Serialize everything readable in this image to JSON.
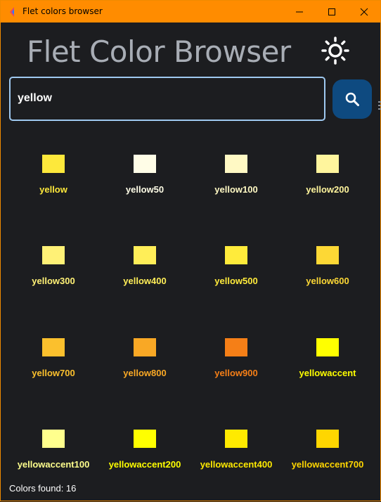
{
  "window": {
    "title": "Flet colors browser",
    "controls": [
      "minimize-icon",
      "maximize-icon",
      "close-icon"
    ]
  },
  "header": {
    "title": "Flet Color Browser",
    "theme_icon": "sun-icon"
  },
  "search": {
    "value": "yellow",
    "button_icon": "search-icon"
  },
  "colors": [
    {
      "name": "yellow",
      "swatch": "#fde83b",
      "label_color": "#fde83b"
    },
    {
      "name": "yellow50",
      "swatch": "#fffde7",
      "label_color": "#fffde7"
    },
    {
      "name": "yellow100",
      "swatch": "#fff9c4",
      "label_color": "#fff9c4"
    },
    {
      "name": "yellow200",
      "swatch": "#fff59d",
      "label_color": "#fff59d"
    },
    {
      "name": "yellow300",
      "swatch": "#fff176",
      "label_color": "#fff176"
    },
    {
      "name": "yellow400",
      "swatch": "#ffee58",
      "label_color": "#ffee58"
    },
    {
      "name": "yellow500",
      "swatch": "#ffeb3b",
      "label_color": "#ffeb3b"
    },
    {
      "name": "yellow600",
      "swatch": "#fdd835",
      "label_color": "#fdd835"
    },
    {
      "name": "yellow700",
      "swatch": "#fbc02d",
      "label_color": "#fbc02d"
    },
    {
      "name": "yellow800",
      "swatch": "#f9a825",
      "label_color": "#f9a825"
    },
    {
      "name": "yellow900",
      "swatch": "#f57f17",
      "label_color": "#f57f17"
    },
    {
      "name": "yellowaccent",
      "swatch": "#ffff00",
      "label_color": "#ffff00"
    },
    {
      "name": "yellowaccent100",
      "swatch": "#ffff8d",
      "label_color": "#ffff8d"
    },
    {
      "name": "yellowaccent200",
      "swatch": "#ffff00",
      "label_color": "#ffff00"
    },
    {
      "name": "yellowaccent400",
      "swatch": "#ffea00",
      "label_color": "#ffea00"
    },
    {
      "name": "yellowaccent700",
      "swatch": "#ffd600",
      "label_color": "#ffd600"
    }
  ],
  "status": {
    "colors_found": "Colors found: 16"
  },
  "theme": {
    "titlebar": "#ff8c00",
    "background": "#1c1d20",
    "search_button": "#0e4a80",
    "search_border": "#9fc9f0"
  }
}
